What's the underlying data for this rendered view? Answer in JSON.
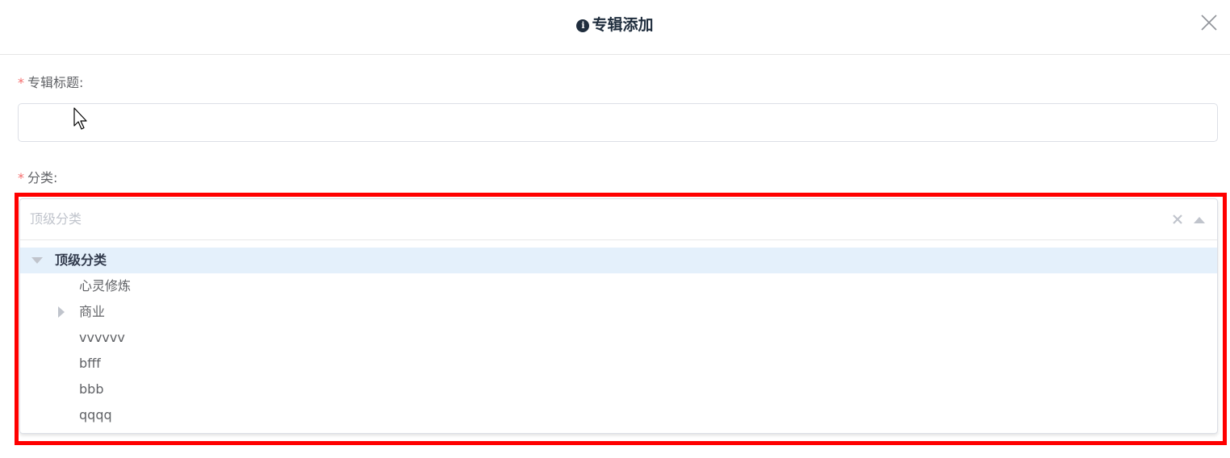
{
  "dialog": {
    "title": "专辑添加",
    "info_glyph": "i"
  },
  "form": {
    "title_field": {
      "required_mark": "*",
      "label": "专辑标题:",
      "value": "",
      "placeholder": ""
    },
    "category_field": {
      "required_mark": "*",
      "label": "分类:",
      "placeholder": "顶级分类"
    }
  },
  "tree": {
    "root": {
      "label": "顶级分类",
      "expanded": true
    },
    "children": [
      {
        "label": "心灵修炼",
        "has_children": false
      },
      {
        "label": "商业",
        "has_children": true
      },
      {
        "label": "vvvvvv",
        "has_children": false
      },
      {
        "label": "bfff",
        "has_children": false
      },
      {
        "label": "bbb",
        "has_children": false
      },
      {
        "label": "qqqq",
        "has_children": false
      }
    ]
  },
  "colors": {
    "required": "#f56c6c",
    "highlight_border": "#ff0000",
    "root_row_bg": "#e4f0fb"
  },
  "icons": {
    "close": "close-icon",
    "clear": "clear-icon",
    "collapse": "arrow-up-icon",
    "tree_expanded": "caret-down-icon",
    "tree_collapsed": "caret-right-icon",
    "info": "info-icon"
  }
}
